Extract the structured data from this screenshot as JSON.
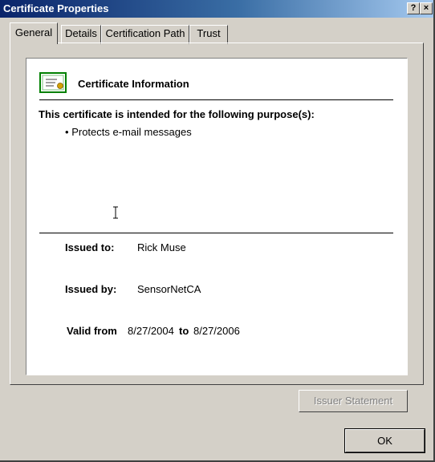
{
  "window": {
    "title": "Certificate Properties",
    "help_glyph": "?",
    "close_glyph": "×"
  },
  "tabs": [
    {
      "label": "General"
    },
    {
      "label": "Details"
    },
    {
      "label": "Certification Path"
    },
    {
      "label": "Trust"
    }
  ],
  "cert": {
    "heading": "Certificate Information",
    "purpose_heading": "This certificate is intended for the following purpose(s):",
    "purposes": [
      "Protects e-mail messages"
    ],
    "bullet": "•",
    "issued_to_label": "Issued to:",
    "issued_to": "Rick Muse",
    "issued_by_label": "Issued by:",
    "issued_by": "SensorNetCA",
    "valid_from_label": "Valid from",
    "valid_from": "8/27/2004",
    "to_label": "to",
    "valid_to": "8/27/2006"
  },
  "buttons": {
    "issuer_statement": "Issuer Statement",
    "ok": "OK"
  },
  "icons": {
    "certificate": "certificate-icon",
    "text_cursor": "text-cursor-icon"
  }
}
